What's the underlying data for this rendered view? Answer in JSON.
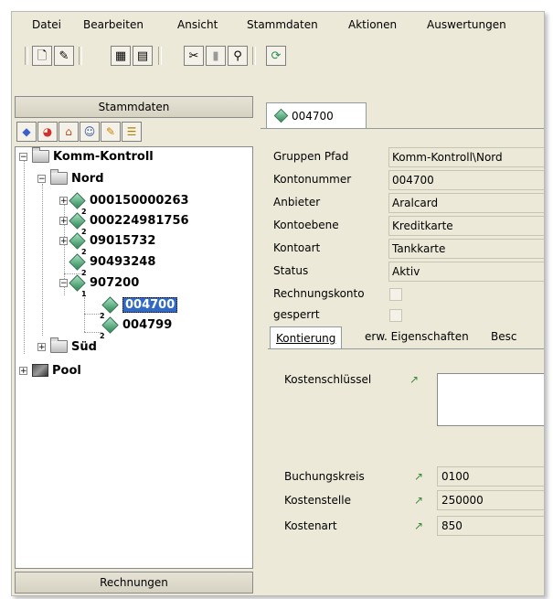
{
  "menu": [
    {
      "label": "Datei"
    },
    {
      "label": "Bearbeiten"
    },
    {
      "label": "Ansicht"
    },
    {
      "label": "Stammdaten"
    },
    {
      "label": "Aktionen"
    },
    {
      "label": "Auswertungen"
    }
  ],
  "left": {
    "header": "Stammdaten",
    "footer": "Rechnungen",
    "tree": {
      "root": "Komm-Kontroll",
      "nord": "Nord",
      "items": [
        "000150000263",
        "000224981756",
        "09015732",
        "90493248",
        "907200"
      ],
      "children": [
        "004700",
        "004799"
      ],
      "sued": "Süd",
      "pool": "Pool"
    }
  },
  "tab": {
    "label": "004700"
  },
  "fields": [
    {
      "label": "Gruppen Pfad",
      "value": "Komm-Kontroll\\Nord"
    },
    {
      "label": "Kontonummer",
      "value": "004700"
    },
    {
      "label": "Anbieter",
      "value": "Aralcard"
    },
    {
      "label": "Kontoebene",
      "value": "Kreditkarte"
    },
    {
      "label": "Kontoart",
      "value": "Tankkarte"
    },
    {
      "label": "Status",
      "value": "Aktiv"
    }
  ],
  "checks": [
    {
      "label": "Rechnungskonto"
    },
    {
      "label": "gesperrt"
    }
  ],
  "subtabs": [
    "Kontierung",
    "erw. Eigenschaften",
    "Besc"
  ],
  "kontierung": {
    "kostenschluessel": "Kostenschlüssel",
    "rows": [
      {
        "label": "Buchungskreis",
        "value": "0100"
      },
      {
        "label": "Kostenstelle",
        "value": "250000"
      },
      {
        "label": "Kostenart",
        "value": "850"
      }
    ]
  },
  "tree_sublevels": [
    "2",
    "2",
    "2",
    "2",
    "1",
    "2",
    "2"
  ]
}
